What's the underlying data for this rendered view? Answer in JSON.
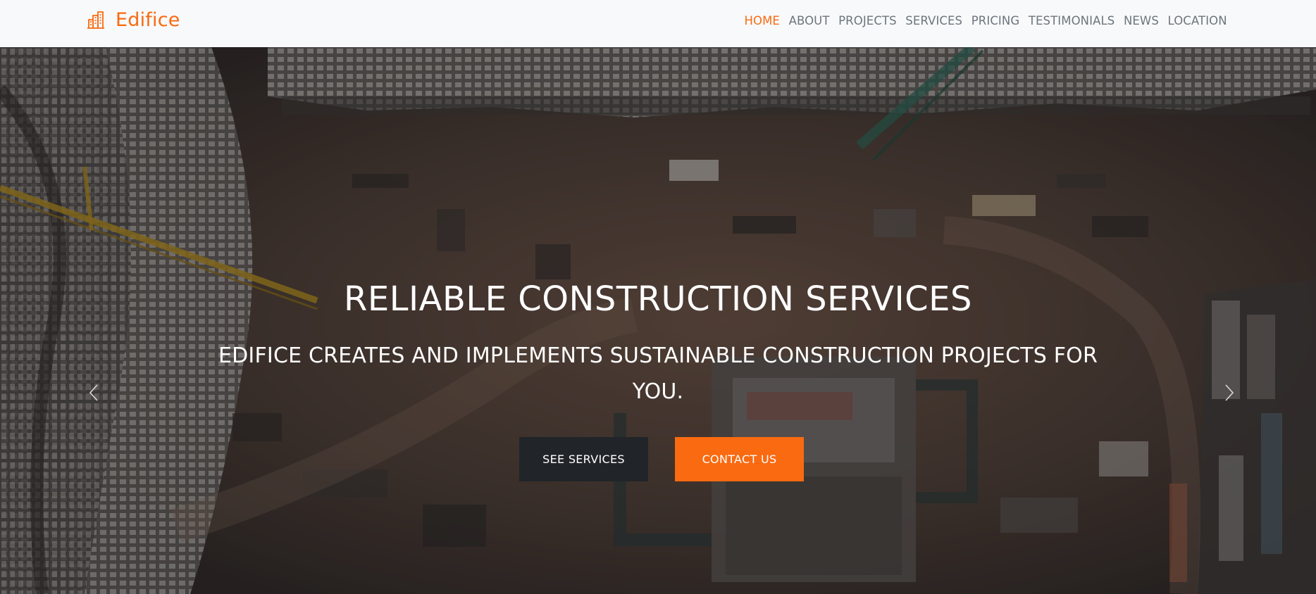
{
  "brand": {
    "name": "Edifice",
    "icon": "building-icon",
    "accent_color": "#f96a11"
  },
  "nav": {
    "items": [
      {
        "label": "HOME",
        "active": true
      },
      {
        "label": "ABOUT",
        "active": false
      },
      {
        "label": "PROJECTS",
        "active": false
      },
      {
        "label": "SERVICES",
        "active": false
      },
      {
        "label": "PRICING",
        "active": false
      },
      {
        "label": "TESTIMONIALS",
        "active": false
      },
      {
        "label": "NEWS",
        "active": false
      },
      {
        "label": "LOCATION",
        "active": false
      }
    ]
  },
  "hero": {
    "title": "RELIABLE CONSTRUCTION SERVICES",
    "subtitle": "EDIFICE CREATES AND IMPLEMENTS SUSTAINABLE CONSTRUCTION PROJECTS FOR YOU.",
    "primary_button": "SEE SERVICES",
    "secondary_button": "CONTACT US",
    "primary_button_color": "#212529",
    "secondary_button_color": "#f96a11",
    "background_image": "aerial-construction-site-photo",
    "prev_icon": "chevron-left-icon",
    "next_icon": "chevron-right-icon"
  }
}
